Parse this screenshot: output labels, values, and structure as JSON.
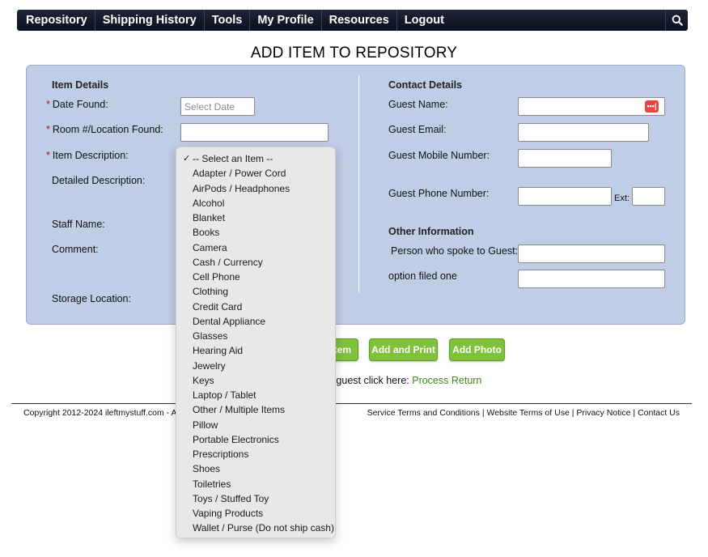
{
  "nav": {
    "items": [
      "Repository",
      "Shipping History",
      "Tools",
      "My Profile",
      "Resources",
      "Logout"
    ]
  },
  "icons": {
    "search": "search-icon",
    "password_manager": "password-manager-icon",
    "check": "checkmark-icon"
  },
  "page_title": "ADD ITEM TO REPOSITORY",
  "item_details": {
    "heading": "Item Details",
    "date_found_label": "Date Found:",
    "date_found_placeholder": "Select Date",
    "room_label": "Room #/Location Found:",
    "item_description_label": "Item Description:",
    "detailed_description_label": "Detailed Description:",
    "staff_name_label": "Staff Name:",
    "comment_label": "Comment:",
    "storage_location_label": "Storage Location:",
    "required_marker": "*"
  },
  "contact_details": {
    "heading": "Contact Details",
    "guest_name_label": "Guest Name:",
    "guest_email_label": "Guest Email:",
    "guest_mobile_label": "Guest Mobile Number:",
    "guest_phone_label": "Guest Phone Number:",
    "ext_label": "Ext:"
  },
  "other_information": {
    "heading": "Other Information",
    "person_spoke_label": "Person who spoke to Guest:",
    "option_filed_label": "option filed one"
  },
  "buttons": {
    "add_item_partial": "tem",
    "add_and_print": "Add and Print",
    "add_photo": "Add Photo"
  },
  "return_line": {
    "text_partial": "e guest click here:",
    "link": "Process Return"
  },
  "footer": {
    "copyright_partial": "Copyright 2012-2024 ileftmystuff.com - All r",
    "links": [
      "Service Terms and Conditions",
      "Website Terms of Use",
      "Privacy Notice",
      "Contact Us"
    ],
    "separator": "|"
  },
  "item_dropdown": {
    "selected": "-- Select an Item --",
    "options": [
      "-- Select an Item --",
      "Adapter / Power Cord",
      "AirPods / Headphones",
      "Alcohol",
      "Blanket",
      "Books",
      "Camera",
      "Cash / Currency",
      "Cell Phone",
      "Clothing",
      "Credit Card",
      "Dental Appliance",
      "Glasses",
      "Hearing Aid",
      "Jewelry",
      "Keys",
      "Laptop / Tablet",
      "Other / Multiple Items",
      "Pillow",
      "Portable Electronics",
      "Prescriptions",
      "Shoes",
      "Toiletries",
      "Toys / Stuffed Toy",
      "Vaping Products",
      "Wallet / Purse (Do not ship cash)"
    ]
  },
  "colors": {
    "nav_bg": "#141a2b",
    "panel_bg": "#c0cde6",
    "button_green": "#7fc13b",
    "link_green": "#3c8a1e",
    "required_red": "#d0021b"
  }
}
